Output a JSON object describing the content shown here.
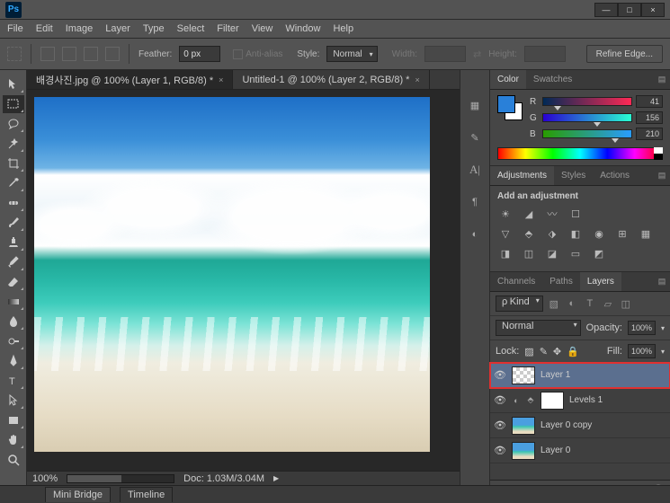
{
  "app": {
    "logo": "Ps"
  },
  "window_controls": {
    "min": "—",
    "max": "□",
    "close": "×"
  },
  "menu": [
    "File",
    "Edit",
    "Image",
    "Layer",
    "Type",
    "Select",
    "Filter",
    "View",
    "Window",
    "Help"
  ],
  "options": {
    "feather_label": "Feather:",
    "feather_value": "0 px",
    "antialias_label": "Anti-alias",
    "style_label": "Style:",
    "style_value": "Normal",
    "width_label": "Width:",
    "height_label": "Height:",
    "refine": "Refine Edge..."
  },
  "tabs": [
    {
      "label": "배경사진.jpg @ 100% (Layer 1, RGB/8) *",
      "active": true
    },
    {
      "label": "Untitled-1 @ 100% (Layer 2, RGB/8) *",
      "active": false
    }
  ],
  "status": {
    "zoom": "100%",
    "doc": "Doc: 1.03M/3.04M",
    "mini_bridge": "Mini Bridge",
    "timeline": "Timeline"
  },
  "color_panel": {
    "tabs": [
      "Color",
      "Swatches"
    ],
    "channels": [
      {
        "label": "R",
        "value": "41",
        "grad": "linear-gradient(90deg,#002955,#ff2955)",
        "pos": 16
      },
      {
        "label": "G",
        "value": "156",
        "grad": "linear-gradient(90deg,#2900d2,#29ffd2)",
        "pos": 61
      },
      {
        "label": "B",
        "value": "210",
        "grad": "linear-gradient(90deg,#299c00,#299cff)",
        "pos": 82
      }
    ]
  },
  "adjustments_panel": {
    "tabs": [
      "Adjustments",
      "Styles",
      "Actions"
    ],
    "title": "Add an adjustment"
  },
  "layers_panel": {
    "tabs": [
      "Channels",
      "Paths",
      "Layers"
    ],
    "kind": "Kind",
    "blend": "Normal",
    "opacity_label": "Opacity:",
    "opacity_value": "100%",
    "lock_label": "Lock:",
    "fill_label": "Fill:",
    "fill_value": "100%",
    "layers": [
      {
        "name": "Layer 1",
        "thumb": "checker",
        "sel": true,
        "hl": true,
        "extra": ""
      },
      {
        "name": "Levels 1",
        "thumb": "white",
        "sel": false,
        "hl": false,
        "extra": "adj"
      },
      {
        "name": "Layer 0 copy",
        "thumb": "img",
        "sel": false,
        "hl": false,
        "extra": ""
      },
      {
        "name": "Layer 0",
        "thumb": "img",
        "sel": false,
        "hl": false,
        "extra": ""
      }
    ]
  },
  "filter_kind_label": "ρ"
}
